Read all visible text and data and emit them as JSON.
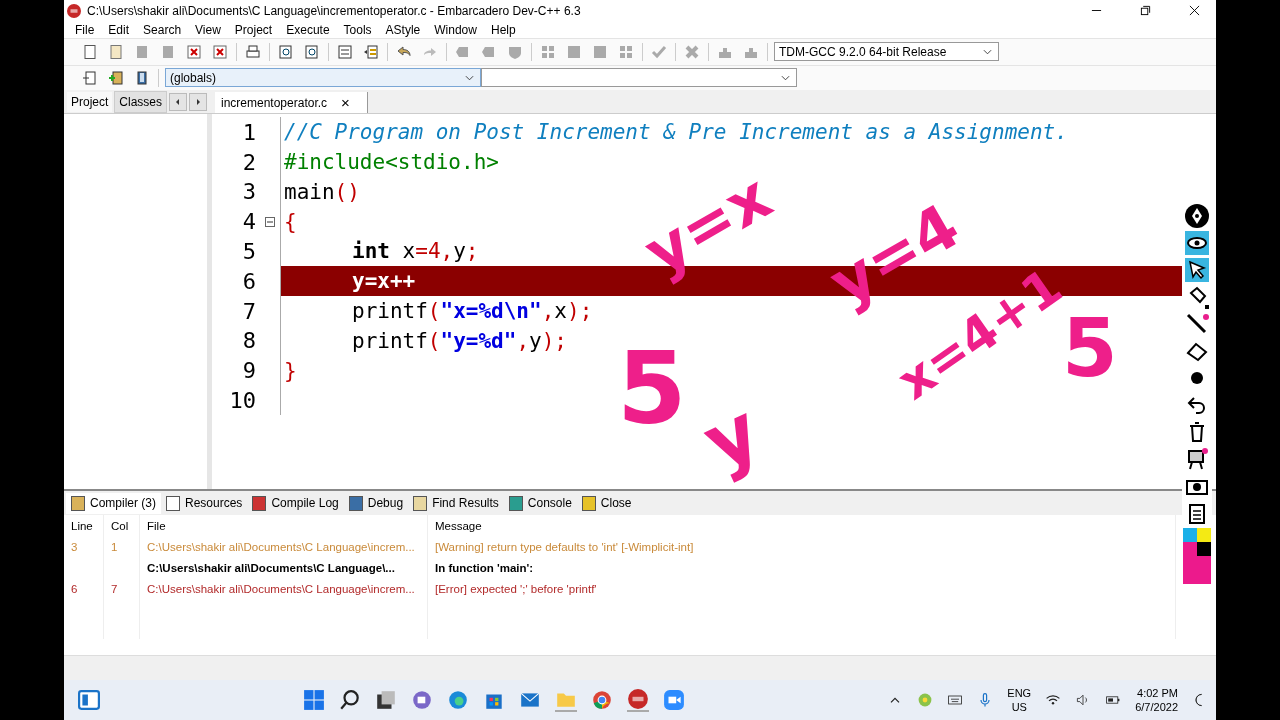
{
  "window": {
    "title": "C:\\Users\\shakir ali\\Documents\\C Language\\incrementoperator.c - Embarcadero Dev-C++ 6.3"
  },
  "menu": [
    "File",
    "Edit",
    "Search",
    "View",
    "Project",
    "Execute",
    "Tools",
    "AStyle",
    "Window",
    "Help"
  ],
  "compiler_select": {
    "value": "TDM-GCC 9.2.0 64-bit Release"
  },
  "scope_select": {
    "value": "(globals)"
  },
  "side_tabs": [
    {
      "label": "Project",
      "selected": true
    },
    {
      "label": "Classes",
      "selected": false
    }
  ],
  "file_tab": {
    "label": "incrementoperator.c",
    "close": "×"
  },
  "code": [
    {
      "number": "1",
      "indented": false,
      "highlighted": false,
      "fold": false,
      "tokens": [
        {
          "kind": "comment",
          "text": "//C Program on Post Increment & Pre Increment as a Assignment."
        }
      ]
    },
    {
      "number": "2",
      "indented": false,
      "highlighted": false,
      "fold": false,
      "tokens": [
        {
          "kind": "preproc",
          "text": "#include<stdio.h>"
        }
      ]
    },
    {
      "number": "3",
      "indented": false,
      "highlighted": false,
      "fold": false,
      "tokens": [
        {
          "kind": "plain",
          "text": "main"
        },
        {
          "kind": "symbol",
          "text": "()"
        }
      ]
    },
    {
      "number": "4",
      "indented": false,
      "highlighted": false,
      "fold": true,
      "tokens": [
        {
          "kind": "symbol",
          "text": "{"
        }
      ]
    },
    {
      "number": "5",
      "indented": true,
      "highlighted": false,
      "fold": false,
      "tokens": [
        {
          "kind": "keyword",
          "text": "int"
        },
        {
          "kind": "plain",
          "text": " x"
        },
        {
          "kind": "symbol",
          "text": "="
        },
        {
          "kind": "number",
          "text": "4"
        },
        {
          "kind": "symbol",
          "text": ","
        },
        {
          "kind": "plain",
          "text": "y"
        },
        {
          "kind": "symbol",
          "text": ";"
        }
      ]
    },
    {
      "number": "6",
      "indented": true,
      "highlighted": true,
      "fold": false,
      "tokens": [
        {
          "kind": "plain",
          "text": "y=x++"
        }
      ]
    },
    {
      "number": "7",
      "indented": true,
      "highlighted": false,
      "fold": false,
      "tokens": [
        {
          "kind": "plain",
          "text": "printf"
        },
        {
          "kind": "symbol",
          "text": "("
        },
        {
          "kind": "string",
          "text": "\"x=%d\\n\""
        },
        {
          "kind": "symbol",
          "text": ","
        },
        {
          "kind": "plain",
          "text": "x"
        },
        {
          "kind": "symbol",
          "text": ");"
        }
      ]
    },
    {
      "number": "8",
      "indented": true,
      "highlighted": false,
      "fold": false,
      "tokens": [
        {
          "kind": "plain",
          "text": "printf"
        },
        {
          "kind": "symbol",
          "text": "("
        },
        {
          "kind": "string",
          "text": "\"y=%d\""
        },
        {
          "kind": "symbol",
          "text": ","
        },
        {
          "kind": "plain",
          "text": "y"
        },
        {
          "kind": "symbol",
          "text": ");"
        }
      ]
    },
    {
      "number": "9",
      "indented": false,
      "highlighted": false,
      "fold": false,
      "tokens": [
        {
          "kind": "symbol",
          "text": "}"
        }
      ]
    },
    {
      "number": "10",
      "highlighted": false,
      "fold": false
    }
  ],
  "ink_notes": [
    "y=x",
    "5",
    "y",
    "y=4",
    "x=4+1",
    "5"
  ],
  "bottom_tabs": [
    {
      "label": "Compiler (3)",
      "selected": true
    },
    {
      "label": "Resources",
      "selected": false
    },
    {
      "label": "Compile Log",
      "selected": false
    },
    {
      "label": "Debug",
      "selected": false
    },
    {
      "label": "Find Results",
      "selected": false
    },
    {
      "label": "Console",
      "selected": false
    },
    {
      "label": "Close",
      "selected": false
    }
  ],
  "messages": {
    "columns": [
      "Line",
      "Col",
      "File",
      "Message"
    ],
    "rows": [
      {
        "kind": "warning",
        "line": "3",
        "col": "1",
        "file": "C:\\Users\\shakir ali\\Documents\\C Language\\increm...",
        "message": "[Warning] return type defaults to 'int' [-Wimplicit-int]"
      },
      {
        "kind": "info",
        "file": "C:\\Users\\shakir ali\\Documents\\C Language\\...",
        "message": "In function 'main':"
      },
      {
        "kind": "error",
        "line": "6",
        "col": "7",
        "file": "C:\\Users\\shakir ali\\Documents\\C Language\\increm...",
        "message": "[Error] expected ';' before 'printf'"
      }
    ]
  },
  "taskbar": {
    "language": "ENG",
    "region": "US",
    "time": "4:02 PM",
    "date": "6/7/2022"
  }
}
